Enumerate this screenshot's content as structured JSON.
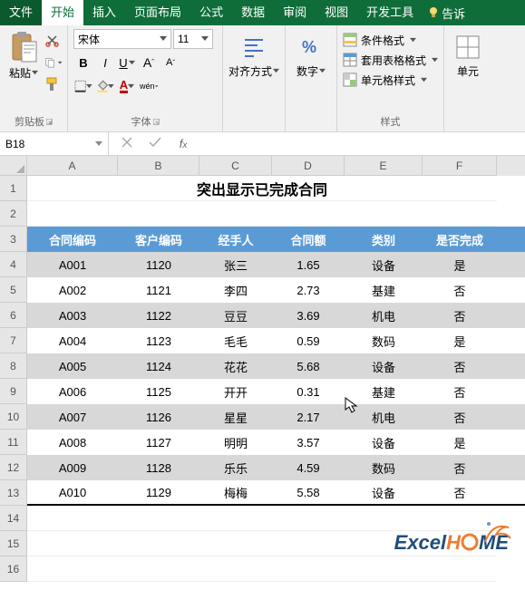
{
  "menu": {
    "file": "文件",
    "home": "开始",
    "insert": "插入",
    "layout": "页面布局",
    "formulas": "公式",
    "data": "数据",
    "review": "审阅",
    "view": "视图",
    "dev": "开发工具",
    "tell": "告诉"
  },
  "ribbon": {
    "clipboard": {
      "paste": "粘贴",
      "label": "剪贴板"
    },
    "font": {
      "name": "宋体",
      "size": "11",
      "label": "字体",
      "wen": "wén"
    },
    "align": {
      "label": "对齐方式"
    },
    "number": {
      "label": "数字"
    },
    "styles": {
      "cond": "条件格式",
      "table": "套用表格格式",
      "cell": "单元格样式",
      "label": "样式"
    },
    "cells": {
      "label": "单元"
    }
  },
  "namebox": "B18",
  "formula": "",
  "columns": [
    "A",
    "B",
    "C",
    "D",
    "E",
    "F"
  ],
  "row_nums": [
    "1",
    "2",
    "3",
    "4",
    "5",
    "6",
    "7",
    "8",
    "9",
    "10",
    "11",
    "12",
    "13",
    "14",
    "15",
    "16"
  ],
  "title": "突出显示已完成合同",
  "headers": [
    "合同编码",
    "客户编码",
    "经手人",
    "合同额",
    "类别",
    "是否完成"
  ],
  "rows": [
    [
      "A001",
      "1120",
      "张三",
      "1.65",
      "设备",
      "是"
    ],
    [
      "A002",
      "1121",
      "李四",
      "2.73",
      "基建",
      "否"
    ],
    [
      "A003",
      "1122",
      "豆豆",
      "3.69",
      "机电",
      "否"
    ],
    [
      "A004",
      "1123",
      "毛毛",
      "0.59",
      "数码",
      "是"
    ],
    [
      "A005",
      "1124",
      "花花",
      "5.68",
      "设备",
      "否"
    ],
    [
      "A006",
      "1125",
      "开开",
      "0.31",
      "基建",
      "否"
    ],
    [
      "A007",
      "1126",
      "星星",
      "2.17",
      "机电",
      "否"
    ],
    [
      "A008",
      "1127",
      "明明",
      "3.57",
      "设备",
      "是"
    ],
    [
      "A009",
      "1128",
      "乐乐",
      "4.59",
      "数码",
      "否"
    ],
    [
      "A010",
      "1129",
      "梅梅",
      "5.58",
      "设备",
      "否"
    ]
  ],
  "logo": {
    "part1": "Excel",
    "part2": "H",
    "part3": "ME"
  },
  "colors": {
    "accent": "#0f6d3a",
    "header": "#5b9bd5",
    "band": "#d8d8d8"
  }
}
